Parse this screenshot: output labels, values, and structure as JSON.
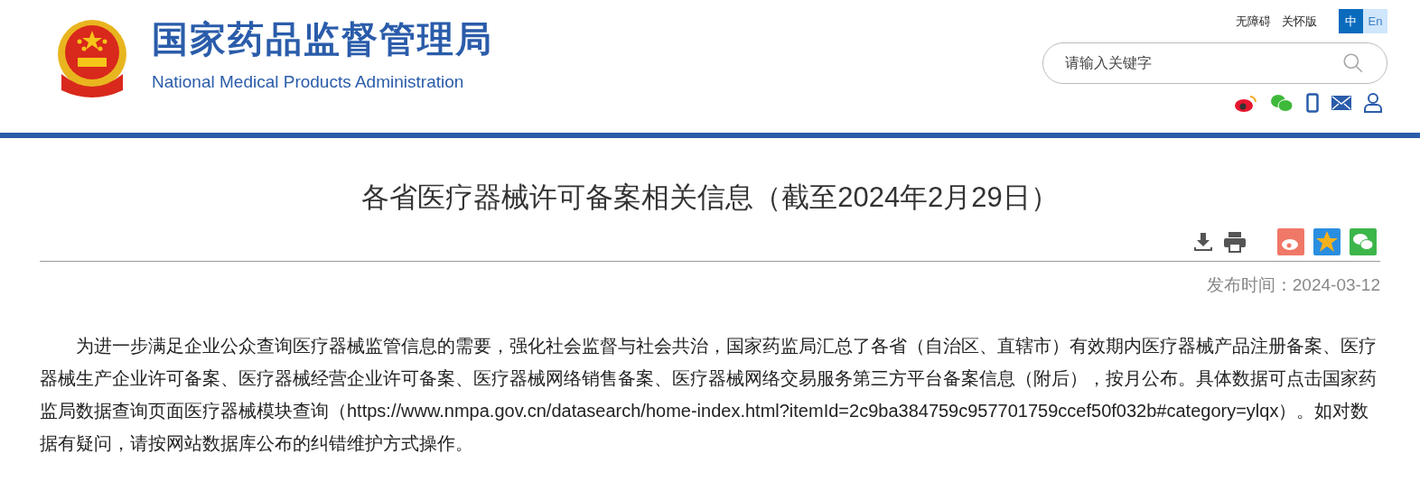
{
  "header": {
    "title_cn": "国家药品监督管理局",
    "title_en": "National Medical Products Administration",
    "links": [
      "无障碍",
      "关怀版"
    ],
    "languages": [
      {
        "label": "中",
        "selected": true
      },
      {
        "label": "En",
        "selected": false
      }
    ],
    "search": {
      "placeholder": "请输入关键字"
    }
  },
  "article": {
    "title": "各省医疗器械许可备案相关信息（截至2024年2月29日）",
    "published": "发布时间：2024-03-12",
    "body": "为进一步满足企业公众查询医疗器械监管信息的需要，强化社会监督与社会共治，国家药监局汇总了各省（自治区、直辖市）有效期内医疗器械产品注册备案、医疗器械生产企业许可备案、医疗器械经营企业许可备案、医疗器械网络销售备案、医疗器械网络交易服务第三方平台备案信息（附后），按月公布。具体数据可点击国家药监局数据查询页面医疗器械模块查询（https://www.nmpa.gov.cn/datasearch/home-index.html?itemId=2c9ba384759c957701759ccef50f032b#category=ylqx）。如对数据有疑问，请按网站数据库公布的纠错维护方式操作。"
  }
}
